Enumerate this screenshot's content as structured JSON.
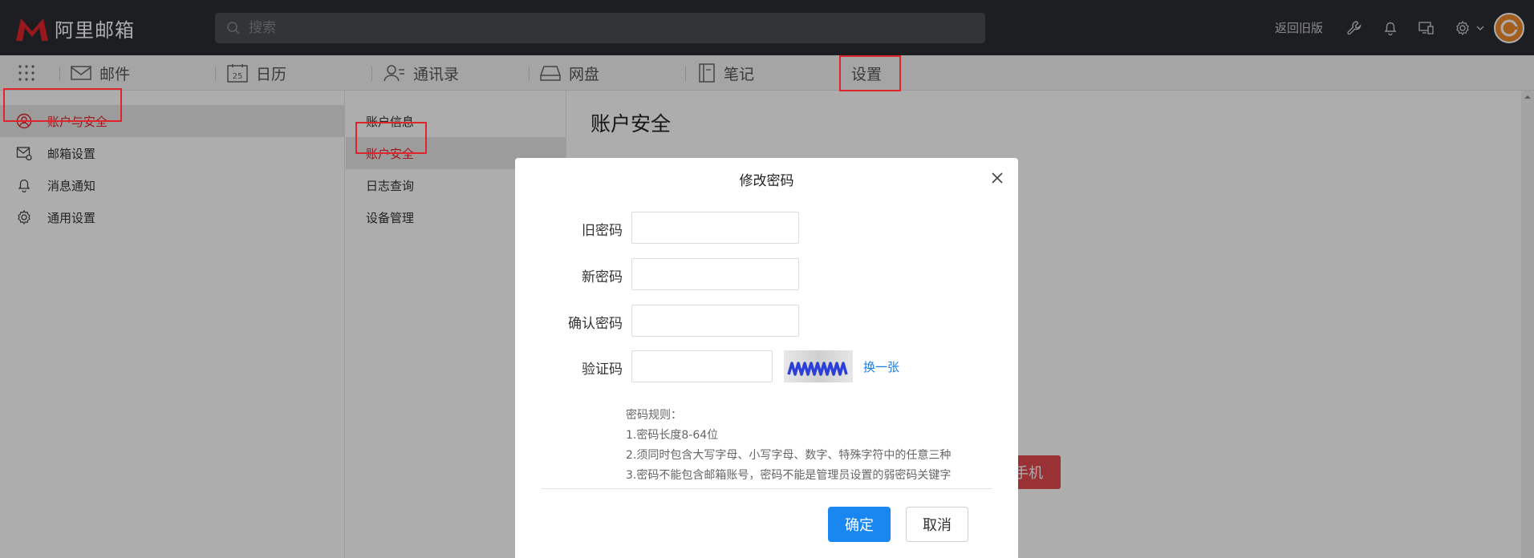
{
  "app": {
    "name": "阿里邮箱"
  },
  "search": {
    "placeholder": "搜索"
  },
  "topbar": {
    "back_old": "返回旧版"
  },
  "nav": {
    "items": [
      {
        "label": "邮件"
      },
      {
        "label": "日历",
        "calendar_day": "25"
      },
      {
        "label": "通讯录"
      },
      {
        "label": "网盘"
      },
      {
        "label": "笔记"
      },
      {
        "label": "设置"
      }
    ]
  },
  "settings_menu": {
    "items": [
      {
        "label": "账户与安全",
        "active": true
      },
      {
        "label": "邮箱设置"
      },
      {
        "label": "消息通知"
      },
      {
        "label": "通用设置"
      }
    ]
  },
  "account_menu": {
    "items": [
      {
        "label": "账户信息"
      },
      {
        "label": "账户安全",
        "active": true
      },
      {
        "label": "日志查询"
      },
      {
        "label": "设备管理"
      }
    ]
  },
  "main": {
    "title": "账户安全",
    "bind_button_fragment": "手机"
  },
  "dialog": {
    "title": "修改密码",
    "old_password_label": "旧密码",
    "old_password_value": "",
    "new_password_label": "新密码",
    "new_password_value": "",
    "confirm_password_label": "确认密码",
    "confirm_password_value": "",
    "captcha_label": "验证码",
    "captcha_value": "",
    "captcha_refresh": "换一张",
    "rules": {
      "heading": "密码规则：",
      "items": [
        "1.密码长度8-64位",
        "2.须同时包含大写字母、小写字母、数字、特殊字符中的任意三种",
        "3.密码不能包含邮箱账号，密码不能是管理员设置的弱密码关键字"
      ]
    },
    "ok_label": "确定",
    "cancel_label": "取消"
  },
  "colors": {
    "accent_red": "#e0242c",
    "primary_blue": "#1a86f0",
    "topbar": "#2a2d32"
  }
}
